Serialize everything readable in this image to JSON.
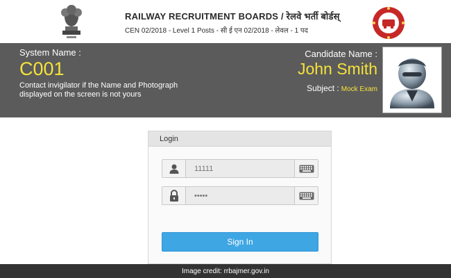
{
  "header": {
    "title": "RAILWAY RECRUITMENT BOARDS / रेलवे भर्ती बोर्डस्",
    "subtitle": "CEN 02/2018 - Level 1 Posts - सी ई एन 02/2018 - लेवल - 1 पद"
  },
  "system": {
    "label": "System Name :",
    "code": "C001",
    "note": "Contact invigilator if the Name and Photograph displayed on the screen is not yours"
  },
  "candidate": {
    "label": "Candidate Name :",
    "name": "John Smith",
    "subject_label": "Subject :",
    "subject_value": "Mock Exam"
  },
  "login": {
    "heading": "Login",
    "username_value": "11111",
    "password_value": "•••••",
    "signin_label": "Sign In",
    "icons": {
      "user": "user-icon",
      "lock": "lock-icon",
      "keyboard": "keyboard-icon"
    }
  },
  "footer": {
    "credit": "Image credit: rrbajmer.gov.in"
  },
  "colors": {
    "band_bg": "#5b5b5b",
    "highlight": "#f5e23a",
    "button": "#3fa6e4",
    "footer_bg": "#333333"
  }
}
